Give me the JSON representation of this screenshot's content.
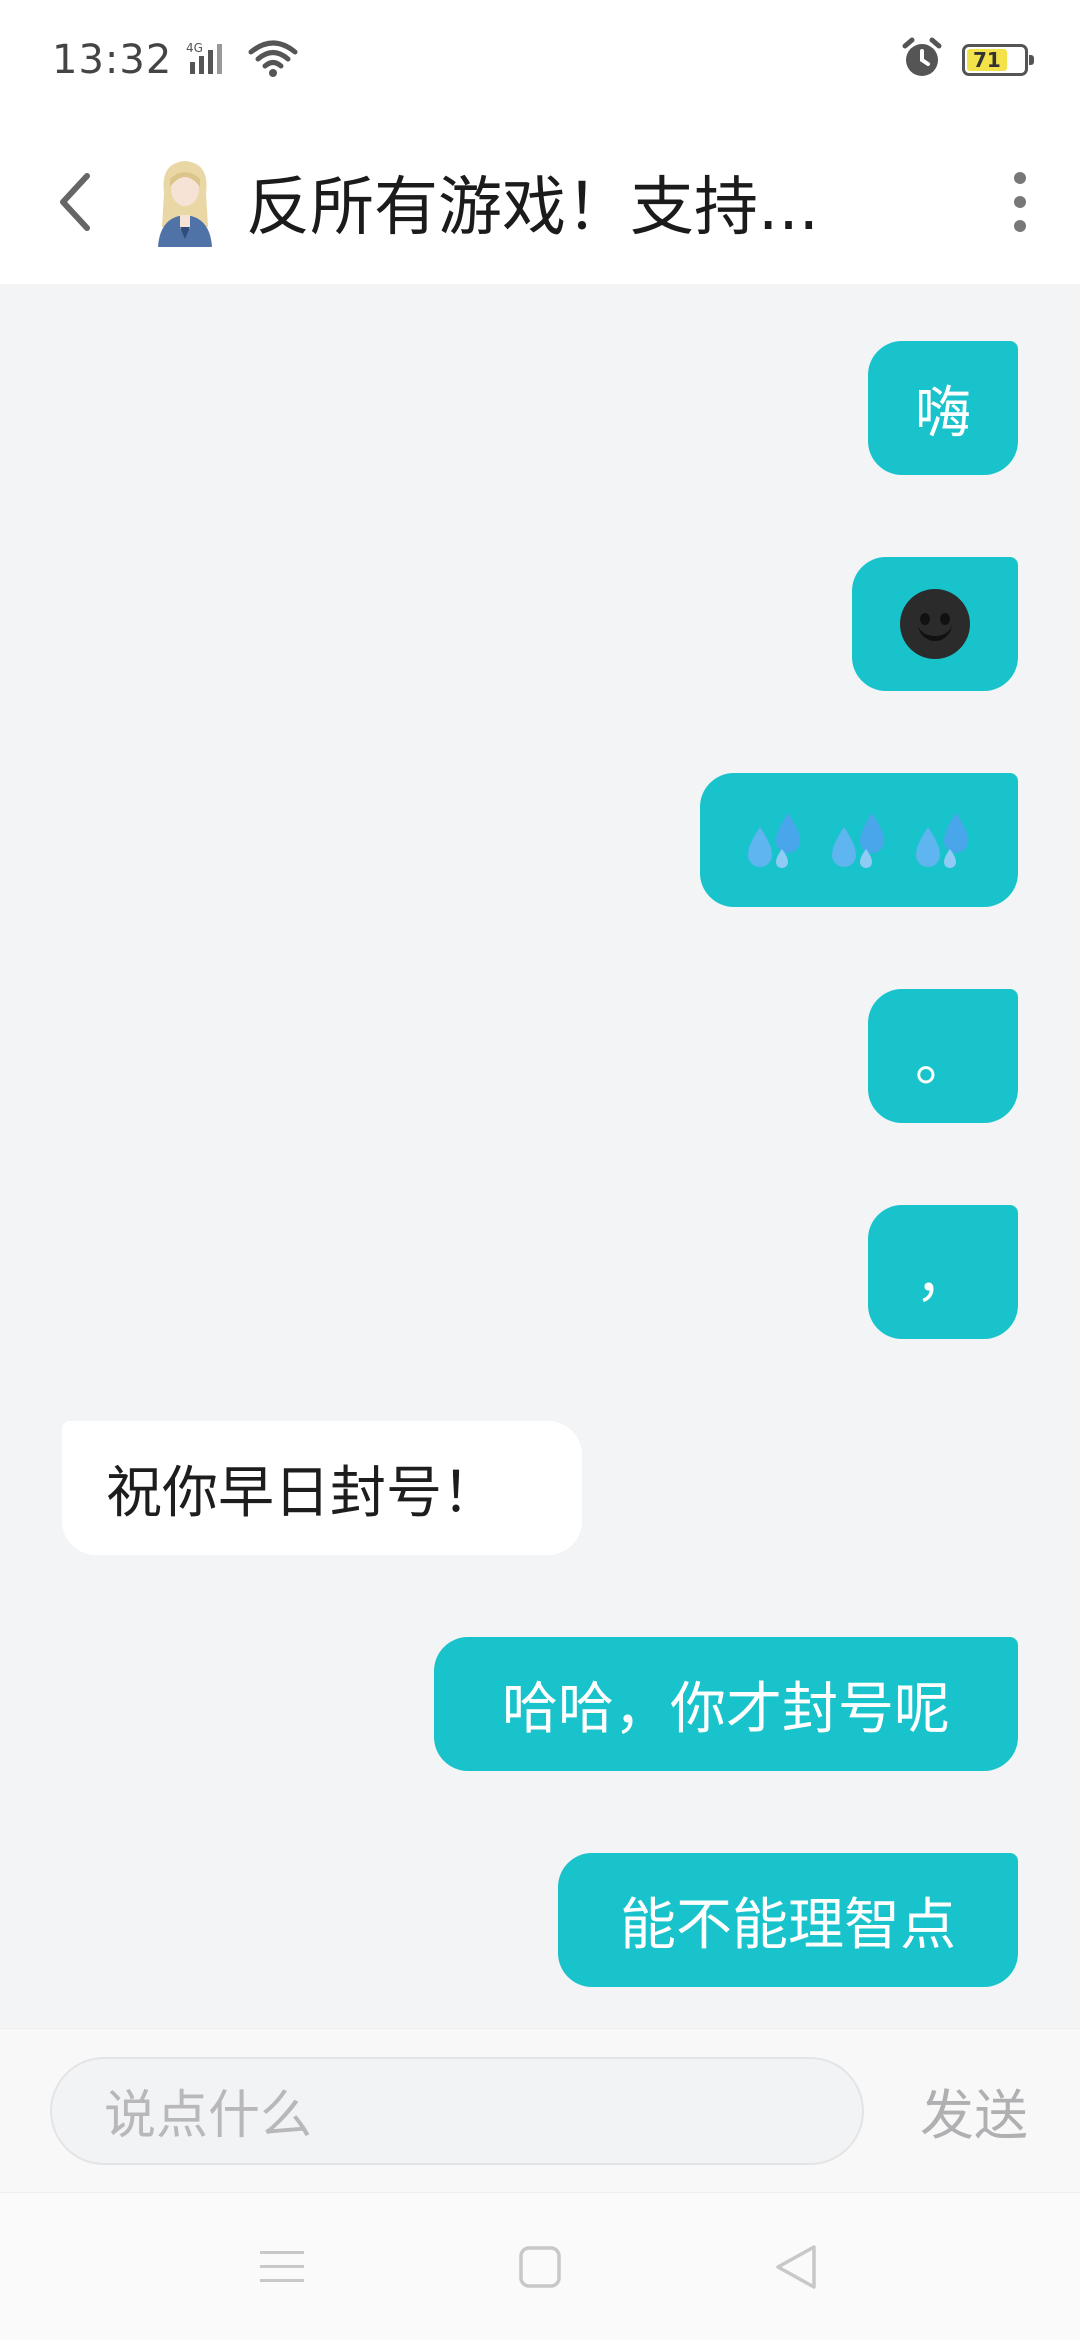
{
  "status_bar": {
    "time": "13:32",
    "network": "4G",
    "battery": "71",
    "icons": [
      "signal-icon",
      "wifi-icon",
      "alarm-icon",
      "battery-icon"
    ]
  },
  "header": {
    "title": "反所有游戏！支持...",
    "icons": [
      "back-arrow-icon",
      "avatar",
      "more-vertical-icon"
    ]
  },
  "messages": [
    {
      "from": "me",
      "text": "嗨"
    },
    {
      "from": "me",
      "emoji": "smiling-face-emoji"
    },
    {
      "from": "me",
      "emoji": "sweat-droplets-emoji x3"
    },
    {
      "from": "me",
      "text": "。"
    },
    {
      "from": "me",
      "text": "，"
    },
    {
      "from": "them",
      "text": "祝你早日封号！"
    },
    {
      "from": "me",
      "text": "哈哈，你才封号呢"
    },
    {
      "from": "me",
      "text": "能不能理智点"
    }
  ],
  "input": {
    "placeholder": "说点什么",
    "send_label": "发送"
  },
  "nav_bar": {
    "icons": [
      "menu-icon",
      "home-square-icon",
      "back-triangle-icon"
    ]
  },
  "colors": {
    "my_bubble": "#19c3cb",
    "their_bubble": "#ffffff",
    "chat_background": "#f3f4f6"
  }
}
